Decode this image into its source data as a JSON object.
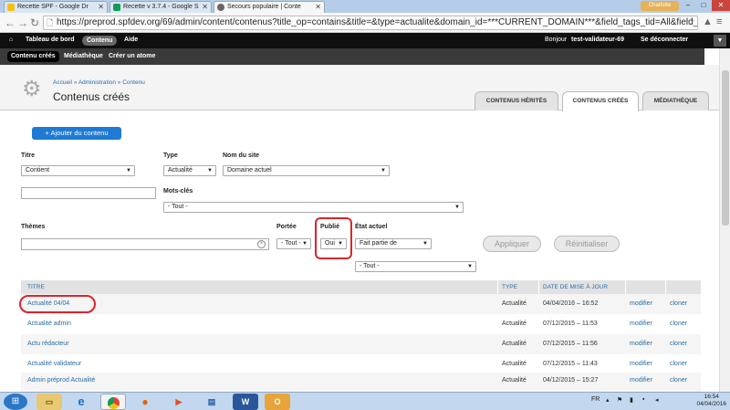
{
  "browser": {
    "tabs": [
      {
        "title": "Recette SPF - Google Dr",
        "icon": "google-drive-icon"
      },
      {
        "title": "Recette v 3.7.4 - Google S",
        "icon": "google-sheets-icon"
      },
      {
        "title": "Secours populaire | Conte",
        "icon": "drupal-icon",
        "active": true
      }
    ],
    "user_chip": "Charlotte",
    "url": "https://preprod.spfdev.org/69/admin/content/contenus?title_op=contains&title=&type=actualite&domain_id=***CURRENT_DOMAIN***&field_tags_tid=All&field_t"
  },
  "toolbar": {
    "home_label": "Tableau de bord",
    "content_label": "Contenu",
    "help_label": "Aide",
    "greeting": "Bonjour",
    "username": "test-validateur-69",
    "logout_label": "Se déconnecter"
  },
  "shortcuts": {
    "items": [
      "Contenu créés",
      "Médiathèque",
      "Créer un atome"
    ]
  },
  "header": {
    "breadcrumb": "Accueil » Administration » Contenu",
    "title": "Contenus créés",
    "tabs": [
      "CONTENUS HÉRITÉS",
      "CONTENUS CRÉÉS",
      "MÉDIATHÈQUE"
    ]
  },
  "content": {
    "add_button": "+ Ajouter du contenu"
  },
  "filters": {
    "titre_label": "Titre",
    "titre_op": "Contient",
    "type_label": "Type",
    "type_value": "Actualité",
    "site_label": "Nom du site",
    "site_value": "Domaine actuel",
    "tags_label": "Mots-clés",
    "tags_value": "- Tout -",
    "themes_label": "Thèmes",
    "portee_label": "Portée",
    "portee_value": "- Tout -",
    "publie_label": "Publié",
    "publie_value": "Oui",
    "etat_label": "État actuel",
    "etat_value": "Fait partie de",
    "etat_value2": "- Tout -",
    "apply_button": "Appliquer",
    "reset_button": "Réinitialiser"
  },
  "table": {
    "headers": [
      "TITRE",
      "TYPE",
      "DATE DE MISE À JOUR"
    ],
    "rows": [
      {
        "title": "Actualité 04/04",
        "type": "Actualité",
        "date": "04/04/2016 – 16:52",
        "edit": "modifier",
        "clone": "cloner"
      },
      {
        "title": "Actualité admin",
        "type": "Actualité",
        "date": "07/12/2015 – 11:53",
        "edit": "modifier",
        "clone": "cloner"
      },
      {
        "title": "Actu rédacteur",
        "type": "Actualité",
        "date": "07/12/2015 – 11:56",
        "edit": "modifier",
        "clone": "cloner"
      },
      {
        "title": "Actualité validateur",
        "type": "Actualité",
        "date": "07/12/2015 – 11:43",
        "edit": "modifier",
        "clone": "cloner"
      },
      {
        "title": "Admin préprod Actualité",
        "type": "Actualité",
        "date": "04/12/2015 – 15:27",
        "edit": "modifier",
        "clone": "cloner"
      }
    ]
  },
  "taskbar": {
    "lang": "FR",
    "time": "16:54",
    "date": "04/04/2016"
  },
  "colors": {
    "link": "#2b6ca3",
    "primary_button": "#1e7ad4",
    "highlight": "#d8262c"
  }
}
